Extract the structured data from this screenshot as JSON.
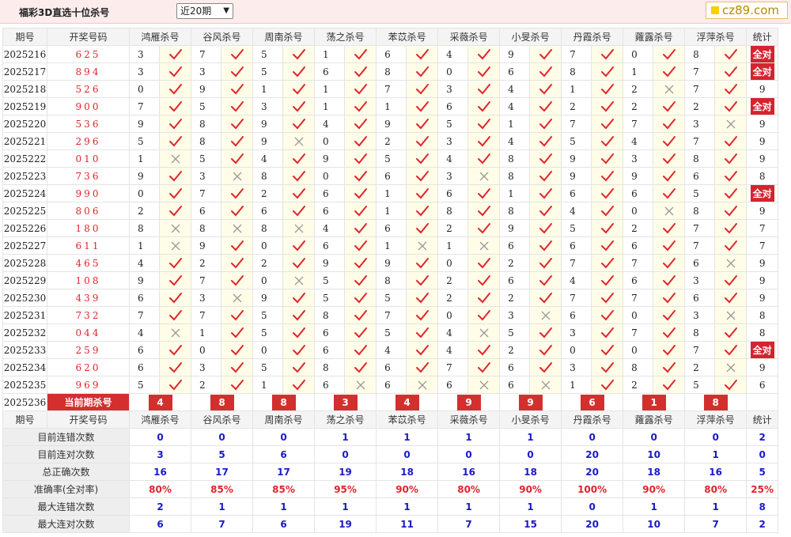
{
  "app": {
    "title": "福彩3D直选十位杀号",
    "period_select": "近20期",
    "logo_text": "cz89.com"
  },
  "columns": {
    "issue": "期号",
    "draw": "开奖号码",
    "experts": [
      "鸿雁杀号",
      "谷风杀号",
      "周南杀号",
      "荡之杀号",
      "苯苡杀号",
      "采薇杀号",
      "小旻杀号",
      "丹霞杀号",
      "蕹露杀号",
      "浮萍杀号"
    ],
    "total": "统计"
  },
  "rows": [
    {
      "issue": "2025216",
      "draw": "625",
      "kills": [
        3,
        7,
        5,
        1,
        6,
        4,
        9,
        7,
        0,
        8
      ],
      "hits": [
        1,
        1,
        1,
        1,
        1,
        1,
        1,
        1,
        1,
        1
      ],
      "total": "全对"
    },
    {
      "issue": "2025217",
      "draw": "894",
      "kills": [
        3,
        3,
        5,
        6,
        8,
        0,
        6,
        8,
        1,
        7
      ],
      "hits": [
        1,
        1,
        1,
        1,
        1,
        1,
        1,
        1,
        1,
        1
      ],
      "total": "全对"
    },
    {
      "issue": "2025218",
      "draw": "526",
      "kills": [
        0,
        9,
        1,
        1,
        7,
        3,
        4,
        1,
        2,
        7
      ],
      "hits": [
        1,
        1,
        1,
        1,
        1,
        1,
        1,
        1,
        0,
        1
      ],
      "total": "9"
    },
    {
      "issue": "2025219",
      "draw": "900",
      "kills": [
        7,
        5,
        3,
        1,
        1,
        6,
        4,
        2,
        2,
        2
      ],
      "hits": [
        1,
        1,
        1,
        1,
        1,
        1,
        1,
        1,
        1,
        1
      ],
      "total": "全对"
    },
    {
      "issue": "2025220",
      "draw": "536",
      "kills": [
        9,
        8,
        9,
        4,
        9,
        5,
        1,
        7,
        7,
        3
      ],
      "hits": [
        1,
        1,
        1,
        1,
        1,
        1,
        1,
        1,
        1,
        0
      ],
      "total": "9"
    },
    {
      "issue": "2025221",
      "draw": "296",
      "kills": [
        5,
        8,
        9,
        0,
        2,
        3,
        4,
        5,
        4,
        7
      ],
      "hits": [
        1,
        1,
        0,
        1,
        1,
        1,
        1,
        1,
        1,
        1
      ],
      "total": "9"
    },
    {
      "issue": "2025222",
      "draw": "010",
      "kills": [
        1,
        5,
        4,
        9,
        5,
        4,
        8,
        9,
        3,
        8
      ],
      "hits": [
        0,
        1,
        1,
        1,
        1,
        1,
        1,
        1,
        1,
        1
      ],
      "total": "9"
    },
    {
      "issue": "2025223",
      "draw": "736",
      "kills": [
        9,
        3,
        8,
        0,
        6,
        3,
        8,
        9,
        9,
        6
      ],
      "hits": [
        1,
        0,
        1,
        1,
        1,
        0,
        1,
        1,
        1,
        1
      ],
      "total": "8"
    },
    {
      "issue": "2025224",
      "draw": "990",
      "kills": [
        0,
        7,
        2,
        6,
        1,
        6,
        1,
        6,
        6,
        5
      ],
      "hits": [
        1,
        1,
        1,
        1,
        1,
        1,
        1,
        1,
        1,
        1
      ],
      "total": "全对"
    },
    {
      "issue": "2025225",
      "draw": "806",
      "kills": [
        2,
        6,
        6,
        6,
        1,
        8,
        8,
        4,
        0,
        8
      ],
      "hits": [
        1,
        1,
        1,
        1,
        1,
        1,
        1,
        1,
        0,
        1
      ],
      "total": "9"
    },
    {
      "issue": "2025226",
      "draw": "180",
      "kills": [
        8,
        8,
        8,
        4,
        6,
        2,
        9,
        5,
        2,
        7
      ],
      "hits": [
        0,
        0,
        0,
        1,
        1,
        1,
        1,
        1,
        1,
        1
      ],
      "total": "7"
    },
    {
      "issue": "2025227",
      "draw": "611",
      "kills": [
        1,
        9,
        0,
        6,
        1,
        1,
        6,
        6,
        6,
        7
      ],
      "hits": [
        0,
        1,
        1,
        1,
        0,
        0,
        1,
        1,
        1,
        1
      ],
      "total": "7"
    },
    {
      "issue": "2025228",
      "draw": "465",
      "kills": [
        4,
        2,
        2,
        9,
        9,
        0,
        2,
        7,
        7,
        6
      ],
      "hits": [
        1,
        1,
        1,
        1,
        1,
        1,
        1,
        1,
        1,
        0
      ],
      "total": "9"
    },
    {
      "issue": "2025229",
      "draw": "108",
      "kills": [
        9,
        7,
        0,
        5,
        8,
        2,
        6,
        4,
        6,
        3
      ],
      "hits": [
        1,
        1,
        0,
        1,
        1,
        1,
        1,
        1,
        1,
        1
      ],
      "total": "9"
    },
    {
      "issue": "2025230",
      "draw": "439",
      "kills": [
        6,
        3,
        9,
        5,
        5,
        2,
        2,
        7,
        7,
        6
      ],
      "hits": [
        1,
        0,
        1,
        1,
        1,
        1,
        1,
        1,
        1,
        1
      ],
      "total": "9"
    },
    {
      "issue": "2025231",
      "draw": "732",
      "kills": [
        7,
        7,
        5,
        8,
        7,
        0,
        3,
        6,
        0,
        3
      ],
      "hits": [
        1,
        1,
        1,
        1,
        1,
        1,
        0,
        1,
        1,
        0
      ],
      "total": "8"
    },
    {
      "issue": "2025232",
      "draw": "044",
      "kills": [
        4,
        1,
        5,
        6,
        5,
        4,
        5,
        3,
        7,
        8
      ],
      "hits": [
        0,
        1,
        1,
        1,
        1,
        0,
        1,
        1,
        1,
        1
      ],
      "total": "8"
    },
    {
      "issue": "2025233",
      "draw": "259",
      "kills": [
        6,
        0,
        0,
        6,
        4,
        4,
        2,
        0,
        0,
        7
      ],
      "hits": [
        1,
        1,
        1,
        1,
        1,
        1,
        1,
        1,
        1,
        1
      ],
      "total": "全对"
    },
    {
      "issue": "2025234",
      "draw": "620",
      "kills": [
        6,
        3,
        5,
        8,
        6,
        7,
        6,
        3,
        8,
        2
      ],
      "hits": [
        1,
        1,
        1,
        1,
        1,
        1,
        1,
        1,
        1,
        0
      ],
      "total": "9"
    },
    {
      "issue": "2025235",
      "draw": "969",
      "kills": [
        5,
        2,
        1,
        6,
        6,
        6,
        6,
        1,
        2,
        5
      ],
      "hits": [
        1,
        1,
        1,
        0,
        0,
        0,
        0,
        1,
        1,
        1
      ],
      "total": "6"
    }
  ],
  "current": {
    "issue": "2025236",
    "label": "当前期杀号",
    "kills": [
      4,
      8,
      8,
      3,
      4,
      9,
      9,
      6,
      1,
      8
    ]
  },
  "stats_header": {
    "issue": "期号",
    "draw": "开奖号码",
    "total": "统计"
  },
  "stats": [
    {
      "label": "目前连错次数",
      "color": "blue",
      "values": [
        "0",
        "0",
        "0",
        "1",
        "1",
        "1",
        "1",
        "0",
        "0",
        "0"
      ],
      "total": "2"
    },
    {
      "label": "目前连对次数",
      "color": "blue",
      "values": [
        "3",
        "5",
        "6",
        "0",
        "0",
        "0",
        "0",
        "20",
        "10",
        "1"
      ],
      "total": "0"
    },
    {
      "label": "总正确次数",
      "color": "blue",
      "values": [
        "16",
        "17",
        "17",
        "19",
        "18",
        "16",
        "18",
        "20",
        "18",
        "16"
      ],
      "total": "5"
    },
    {
      "label": "准确率(全对率)",
      "color": "red",
      "values": [
        "80%",
        "85%",
        "85%",
        "95%",
        "90%",
        "80%",
        "90%",
        "100%",
        "90%",
        "80%"
      ],
      "total": "25%"
    },
    {
      "label": "最大连错次数",
      "color": "blue",
      "values": [
        "2",
        "1",
        "1",
        "1",
        "1",
        "1",
        "1",
        "0",
        "1",
        "1"
      ],
      "total": "8"
    },
    {
      "label": "最大连对次数",
      "color": "blue",
      "values": [
        "6",
        "7",
        "6",
        "19",
        "11",
        "7",
        "15",
        "20",
        "10",
        "7"
      ],
      "total": "2"
    }
  ],
  "icons": {
    "hit": "check-icon",
    "miss": "cross-icon"
  },
  "colors": {
    "accent_red": "#d32f2f",
    "check_red": "#e0242c",
    "stat_blue": "#1a1acb",
    "header_bg": "#fdecec"
  }
}
